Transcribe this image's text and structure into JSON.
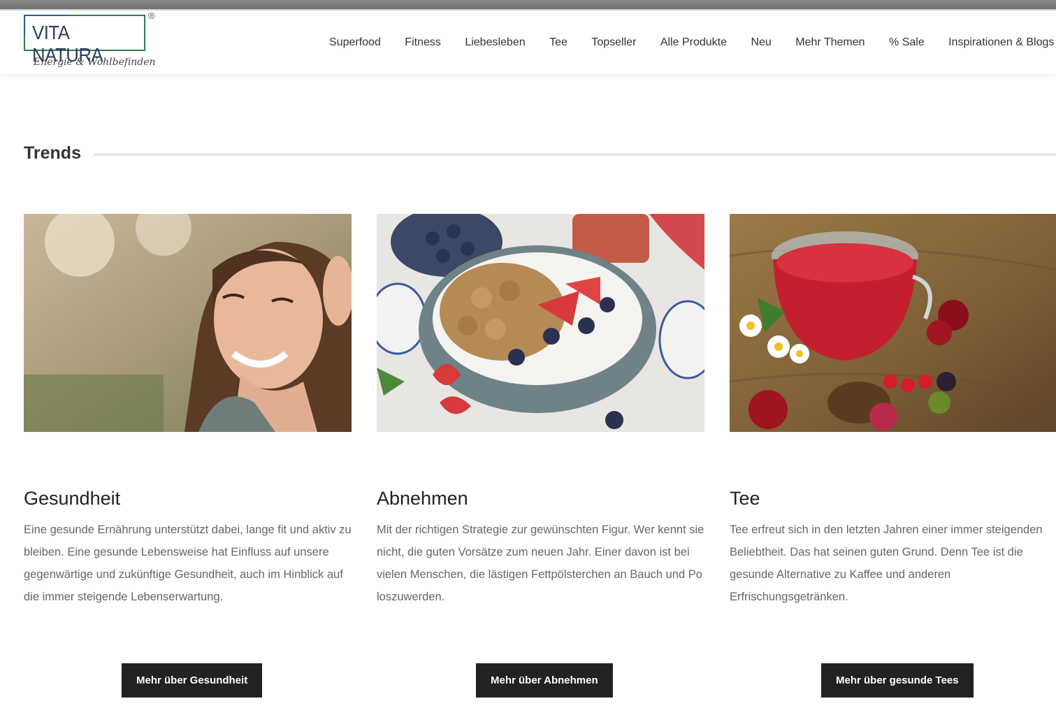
{
  "logo": {
    "name": "VITA NATURA",
    "registered": "®",
    "tagline": "Energie & Wohlbefinden"
  },
  "nav": {
    "items": [
      {
        "label": "Superfood"
      },
      {
        "label": "Fitness"
      },
      {
        "label": "Liebesleben"
      },
      {
        "label": "Tee"
      },
      {
        "label": "Topseller"
      },
      {
        "label": "Alle Produkte"
      },
      {
        "label": "Neu"
      },
      {
        "label": "Mehr Themen"
      },
      {
        "label": "% Sale"
      },
      {
        "label": "Inspirationen & Blogs"
      }
    ]
  },
  "section": {
    "title": "Trends"
  },
  "cards": [
    {
      "title": "Gesundheit",
      "text": "Eine gesunde Ernährung unterstützt dabei, lange fit und aktiv zu bleiben. Eine gesunde Lebensweise hat Einfluss auf unsere gegenwärtige und zukünftige Gesundheit, auch im Hinblick auf die immer steigende Lebenserwartung.",
      "button": "Mehr über Gesundheit"
    },
    {
      "title": "Abnehmen",
      "text": "Mit der richtigen Strategie zur gewünschten Figur. Wer kennt sie nicht, die guten Vorsätze zum neuen Jahr. Einer davon ist bei vielen Menschen, die lästigen Fettpölsterchen an Bauch und Po loszuwerden.",
      "button": "Mehr über Abnehmen"
    },
    {
      "title": "Tee",
      "text": "Tee erfreut sich in den letzten Jahren einer immer steigenden Beliebtheit. Das hat seinen guten Grund. Denn Tee ist die gesunde Alternative zu Kaffee und anderen Erfrischungsgetränken.",
      "button": "Mehr über gesunde Tees"
    }
  ]
}
